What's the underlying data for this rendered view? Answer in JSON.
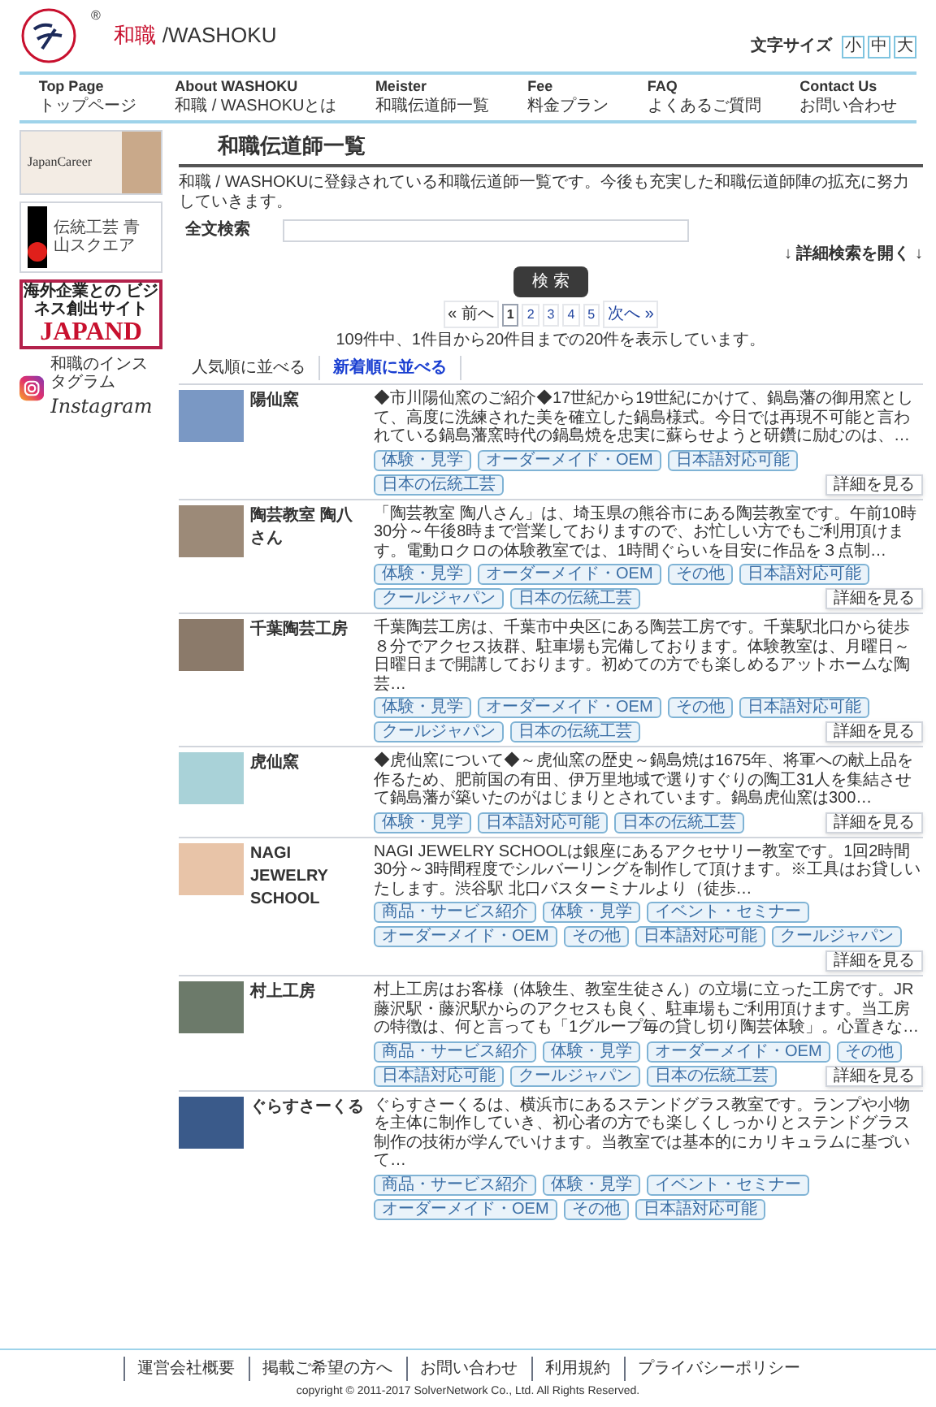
{
  "header": {
    "registered_mark": "®",
    "title_ja": "和職",
    "title_en": "/WASHOKU",
    "font_size": {
      "label": "文字サイズ",
      "options": [
        "小",
        "中",
        "大"
      ]
    }
  },
  "nav": [
    {
      "label": "Top Page",
      "sub": "トップページ"
    },
    {
      "label": "About WASHOKU",
      "sub": "和職 / WASHOKUとは"
    },
    {
      "label": "Meister",
      "sub": "和職伝道師一覧"
    },
    {
      "label": "Fee",
      "sub": "料金プラン"
    },
    {
      "label": "FAQ",
      "sub": "よくあるご質問"
    },
    {
      "label": "Contact Us",
      "sub": "お問い合わせ"
    }
  ],
  "sidebar": {
    "banners": [
      {
        "kind": "career",
        "text": "JapanCareer"
      },
      {
        "kind": "craft",
        "text": "伝統工芸 青山スクエア"
      },
      {
        "kind": "japand",
        "caption": "海外企業との ビジネス創出サイト",
        "text": "JAPAND"
      },
      {
        "kind": "instagram",
        "caption": "和職のインスタグラム",
        "text": "Instagram"
      }
    ]
  },
  "main": {
    "title": "和職伝道師一覧",
    "intro": "和職 / WASHOKUに登録されている和職伝道師一覧です。今後も充実した和職伝道師陣の拡充に努力していきます。",
    "search": {
      "label": "全文検索",
      "advanced_link": "↓ 詳細検索を開く ↓",
      "button": "検 索"
    },
    "pagination": {
      "prev": "« 前へ",
      "pages": [
        {
          "label": "1",
          "selected": true
        },
        {
          "label": "2",
          "selected": false
        },
        {
          "label": "3",
          "selected": false
        },
        {
          "label": "4",
          "selected": false
        },
        {
          "label": "5",
          "selected": false
        }
      ],
      "next": "次へ »"
    },
    "result_count": "109件中、1件目から20件目までの20件を表示しています。",
    "sort_tabs": [
      {
        "label": "人気順に並べる",
        "selected": false
      },
      {
        "label": "新着順に並べる",
        "selected": true
      }
    ],
    "entries": [
      {
        "name": "陽仙窯",
        "description": "◆市川陽仙窯のご紹介◆17世紀から19世紀にかけて、鍋島藩の御用窯として、高度に洗練された美を確立した鍋島様式。今日では再現不可能と言われている鍋島藩窯時代の鍋島焼を忠実に蘇らせようと研鑽に励むのは、…",
        "tags": [
          "体験・見学",
          "オーダーメイド・OEM",
          "日本語対応可能",
          "日本の伝統工芸"
        ],
        "detail_button": "詳細を見る"
      },
      {
        "name": "陶芸教室 陶八さん",
        "description": "「陶芸教室 陶八さん」は、埼玉県の熊谷市にある陶芸教室です。午前10時30分～午後8時まで営業しておりますので、お忙しい方でもご利用頂けます。電動ロクロの体験教室では、1時間ぐらいを目安に作品を３点制…",
        "tags": [
          "体験・見学",
          "オーダーメイド・OEM",
          "その他",
          "日本語対応可能",
          "クールジャパン",
          "日本の伝統工芸"
        ],
        "detail_button": "詳細を見る"
      },
      {
        "name": "千葉陶芸工房",
        "description": "千葉陶芸工房は、千葉市中央区にある陶芸工房です。千葉駅北口から徒歩８分でアクセス抜群、駐車場も完備しております。体験教室は、月曜日～日曜日まで開講しております。初めての方でも楽しめるアットホームな陶芸…",
        "tags": [
          "体験・見学",
          "オーダーメイド・OEM",
          "その他",
          "日本語対応可能",
          "クールジャパン",
          "日本の伝統工芸"
        ],
        "detail_button": "詳細を見る"
      },
      {
        "name": "虎仙窯",
        "description": "◆虎仙窯について◆～虎仙窯の歴史～鍋島焼は1675年、将軍への献上品を作るため、肥前国の有田、伊万里地域で選りすぐりの陶工31人を集結させて鍋島藩が築いたのがはじまりとされています。鍋島虎仙窯は300…",
        "tags": [
          "体験・見学",
          "日本語対応可能",
          "日本の伝統工芸"
        ],
        "detail_button": "詳細を見る"
      },
      {
        "name": "NAGI JEWELRY SCHOOL",
        "description": "NAGI JEWELRY SCHOOLは銀座にあるアクセサリー教室です。1回2時間30分～3時間程度でシルバーリングを制作して頂けます。※工具はお貸しいたします。渋谷駅 北口バスターミナルより（徒歩…",
        "tags": [
          "商品・サービス紹介",
          "体験・見学",
          "イベント・セミナー",
          "オーダーメイド・OEM",
          "その他",
          "日本語対応可能",
          "クールジャパン"
        ],
        "detail_button": "詳細を見る"
      },
      {
        "name": "村上工房",
        "description": "村上工房はお客様（体験生、教室生徒さん）の立場に立った工房です。JR藤沢駅・藤沢駅からのアクセスも良く、駐車場もご利用頂けます。当工房の特徴は、何と言っても「1グループ毎の貸し切り陶芸体験」。心置きな…",
        "tags": [
          "商品・サービス紹介",
          "体験・見学",
          "オーダーメイド・OEM",
          "その他",
          "日本語対応可能",
          "クールジャパン",
          "日本の伝統工芸"
        ],
        "detail_button": "詳細を見る"
      },
      {
        "name": "ぐらすさーくる",
        "description": "ぐらすさーくるは、横浜市にあるステンドグラス教室です。ランプや小物を主体に制作していき、初心者の方でも楽しくしっかりとステンドグラス制作の技術が学んでいけます。当教室では基本的にカリキュラムに基づいて…",
        "tags": [
          "商品・サービス紹介",
          "体験・見学",
          "イベント・セミナー",
          "オーダーメイド・OEM",
          "その他",
          "日本語対応可能"
        ]
      }
    ]
  },
  "footer": {
    "links": [
      "運営会社概要",
      "掲載ご希望の方へ",
      "お問い合わせ",
      "利用規約",
      "プライバシーポリシー"
    ],
    "copyright": "copyright © 2011-2017 SolverNetwork Co., Ltd. All Rights Reserved."
  }
}
